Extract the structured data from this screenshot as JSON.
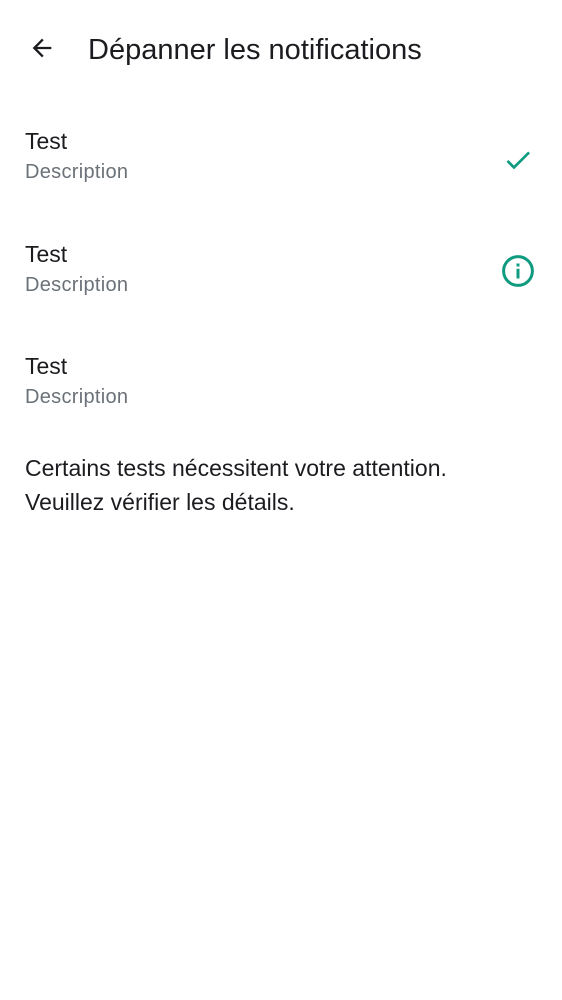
{
  "app_bar": {
    "back_icon": "arrow-back-icon",
    "title": "Dépanner les notifications"
  },
  "tests": [
    {
      "title": "Test",
      "description": "Description",
      "status_icon": "check-icon"
    },
    {
      "title": "Test",
      "description": "Description",
      "status_icon": "info-icon"
    },
    {
      "title": "Test",
      "description": "Description",
      "status_icon": ""
    }
  ],
  "summary": {
    "line1": "Certains tests nécessitent votre attention.",
    "line2": "Veuillez vérifier les détails."
  },
  "colors": {
    "accent": "#0f9b80",
    "text_primary": "#1c1b1f",
    "text_secondary": "#6b7178",
    "background": "#ffffff"
  }
}
